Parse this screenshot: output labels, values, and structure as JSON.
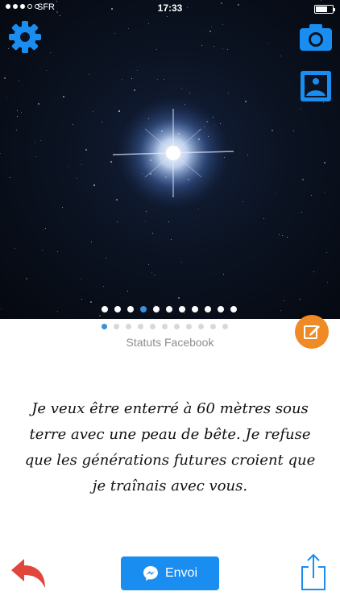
{
  "status_bar": {
    "carrier": "SFR",
    "time": "17:33"
  },
  "photo": {
    "page_count": 11,
    "active_page": 4
  },
  "text_pager": {
    "page_count": 11,
    "active_page": 1
  },
  "category": "Statuts Facebook",
  "quote": "Je veux être enterré à 60 mètres sous terre avec une peau de bête. Je refuse que les générations futures croient que je traînais avec vous.",
  "actions": {
    "send_label": "Envoi"
  },
  "colors": {
    "accent_blue": "#1a8ef0",
    "edit_orange": "#f08a24",
    "back_red": "#e0463c"
  },
  "icons": {
    "settings": "gear-icon",
    "camera": "camera-icon",
    "gallery": "image-gallery-icon",
    "edit": "edit-icon",
    "back": "reply-arrow-icon",
    "messenger": "messenger-icon",
    "share": "share-icon"
  }
}
